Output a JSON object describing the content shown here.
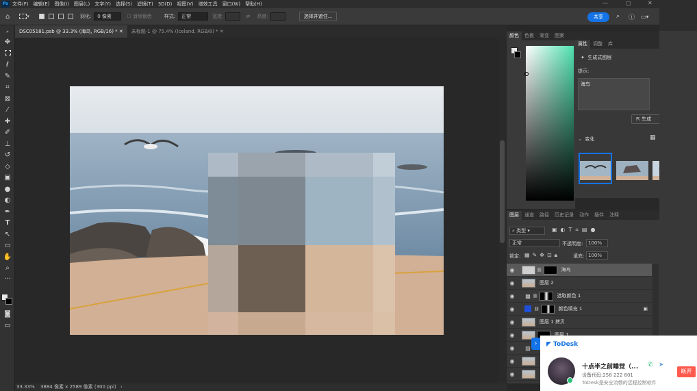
{
  "menubar": {
    "logo": "Ps",
    "items": [
      "文件(F)",
      "编辑(E)",
      "图像(I)",
      "图层(L)",
      "文字(Y)",
      "选择(S)",
      "滤镜(T)",
      "3D(D)",
      "视图(V)",
      "增效工具",
      "窗口(W)",
      "帮助(H)"
    ]
  },
  "options": {
    "feather_label": "羽化:",
    "feather_value": "0 像素",
    "antialias_label": "消除锯齿",
    "style_label": "样式:",
    "style_value": "正常",
    "width_label": "宽度:",
    "height_label": "高度:",
    "select_mask_button": "选择并遮住...",
    "share_button": "共享"
  },
  "tabs": [
    {
      "label": "DSC05181.psb @ 33.3% (海鸟, RGB/16) *"
    },
    {
      "label": "未标题-1 @ 75.4% (Iceland, RGB/8) *"
    }
  ],
  "status": {
    "zoom": "33.33%",
    "doc_info": "3884 像素 x 2589 像素 (300 ppi)"
  },
  "color_panel": {
    "tabs": [
      "颜色",
      "色板",
      "渐变",
      "图案"
    ]
  },
  "properties": {
    "tabs": [
      "属性",
      "调整",
      "库"
    ],
    "section_title": "生成式图层",
    "prompt_label": "提示:",
    "prompt_value": "海鸟",
    "generate_button": "生成",
    "variations_label": "变化"
  },
  "layers_panel": {
    "tabs": [
      "图层",
      "通道",
      "路径",
      "历史记录",
      "动作",
      "插件",
      "注释"
    ],
    "filter_label": "类型",
    "blend_mode": "正常",
    "opacity_label": "不透明度:",
    "opacity_value": "100%",
    "lock_label": "锁定:",
    "fill_label": "填充:",
    "fill_value": "100%",
    "layers": [
      {
        "name": "海鸟",
        "selected": true
      },
      {
        "name": "图层 2",
        "selected": false
      },
      {
        "name": "选取颜色 1",
        "selected": false
      },
      {
        "name": "颜色填充 1",
        "selected": false
      },
      {
        "name": "图层 1 拷贝",
        "selected": false
      },
      {
        "name": "图层 1",
        "selected": false
      },
      {
        "name": "",
        "selected": false
      },
      {
        "name": "",
        "selected": false
      },
      {
        "name": "",
        "selected": false
      }
    ]
  },
  "todesk": {
    "brand": "ToDesk",
    "user_name": "十点半之前睡觉（...",
    "device_code": "设备代码:258 222 801",
    "tagline": "ToDesk是安全流畅的远程控制软件",
    "disconnect_button": "断开"
  },
  "colors": {
    "accent": "#1473e6",
    "disconnect": "#ff5a4d",
    "panel_bg": "#383838"
  }
}
